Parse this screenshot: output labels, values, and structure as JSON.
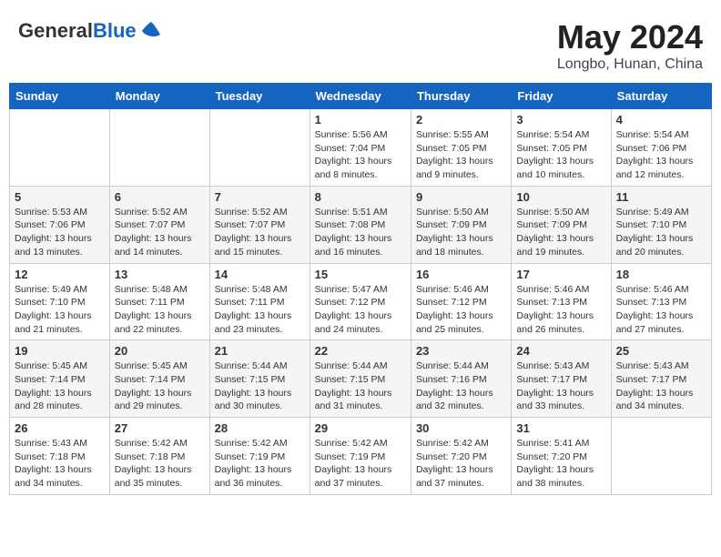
{
  "header": {
    "logo_general": "General",
    "logo_blue": "Blue",
    "title": "May 2024",
    "location": "Longbo, Hunan, China"
  },
  "weekdays": [
    "Sunday",
    "Monday",
    "Tuesday",
    "Wednesday",
    "Thursday",
    "Friday",
    "Saturday"
  ],
  "weeks": [
    [
      {
        "day": "",
        "info": ""
      },
      {
        "day": "",
        "info": ""
      },
      {
        "day": "",
        "info": ""
      },
      {
        "day": "1",
        "info": "Sunrise: 5:56 AM\nSunset: 7:04 PM\nDaylight: 13 hours\nand 8 minutes."
      },
      {
        "day": "2",
        "info": "Sunrise: 5:55 AM\nSunset: 7:05 PM\nDaylight: 13 hours\nand 9 minutes."
      },
      {
        "day": "3",
        "info": "Sunrise: 5:54 AM\nSunset: 7:05 PM\nDaylight: 13 hours\nand 10 minutes."
      },
      {
        "day": "4",
        "info": "Sunrise: 5:54 AM\nSunset: 7:06 PM\nDaylight: 13 hours\nand 12 minutes."
      }
    ],
    [
      {
        "day": "5",
        "info": "Sunrise: 5:53 AM\nSunset: 7:06 PM\nDaylight: 13 hours\nand 13 minutes."
      },
      {
        "day": "6",
        "info": "Sunrise: 5:52 AM\nSunset: 7:07 PM\nDaylight: 13 hours\nand 14 minutes."
      },
      {
        "day": "7",
        "info": "Sunrise: 5:52 AM\nSunset: 7:07 PM\nDaylight: 13 hours\nand 15 minutes."
      },
      {
        "day": "8",
        "info": "Sunrise: 5:51 AM\nSunset: 7:08 PM\nDaylight: 13 hours\nand 16 minutes."
      },
      {
        "day": "9",
        "info": "Sunrise: 5:50 AM\nSunset: 7:09 PM\nDaylight: 13 hours\nand 18 minutes."
      },
      {
        "day": "10",
        "info": "Sunrise: 5:50 AM\nSunset: 7:09 PM\nDaylight: 13 hours\nand 19 minutes."
      },
      {
        "day": "11",
        "info": "Sunrise: 5:49 AM\nSunset: 7:10 PM\nDaylight: 13 hours\nand 20 minutes."
      }
    ],
    [
      {
        "day": "12",
        "info": "Sunrise: 5:49 AM\nSunset: 7:10 PM\nDaylight: 13 hours\nand 21 minutes."
      },
      {
        "day": "13",
        "info": "Sunrise: 5:48 AM\nSunset: 7:11 PM\nDaylight: 13 hours\nand 22 minutes."
      },
      {
        "day": "14",
        "info": "Sunrise: 5:48 AM\nSunset: 7:11 PM\nDaylight: 13 hours\nand 23 minutes."
      },
      {
        "day": "15",
        "info": "Sunrise: 5:47 AM\nSunset: 7:12 PM\nDaylight: 13 hours\nand 24 minutes."
      },
      {
        "day": "16",
        "info": "Sunrise: 5:46 AM\nSunset: 7:12 PM\nDaylight: 13 hours\nand 25 minutes."
      },
      {
        "day": "17",
        "info": "Sunrise: 5:46 AM\nSunset: 7:13 PM\nDaylight: 13 hours\nand 26 minutes."
      },
      {
        "day": "18",
        "info": "Sunrise: 5:46 AM\nSunset: 7:13 PM\nDaylight: 13 hours\nand 27 minutes."
      }
    ],
    [
      {
        "day": "19",
        "info": "Sunrise: 5:45 AM\nSunset: 7:14 PM\nDaylight: 13 hours\nand 28 minutes."
      },
      {
        "day": "20",
        "info": "Sunrise: 5:45 AM\nSunset: 7:14 PM\nDaylight: 13 hours\nand 29 minutes."
      },
      {
        "day": "21",
        "info": "Sunrise: 5:44 AM\nSunset: 7:15 PM\nDaylight: 13 hours\nand 30 minutes."
      },
      {
        "day": "22",
        "info": "Sunrise: 5:44 AM\nSunset: 7:15 PM\nDaylight: 13 hours\nand 31 minutes."
      },
      {
        "day": "23",
        "info": "Sunrise: 5:44 AM\nSunset: 7:16 PM\nDaylight: 13 hours\nand 32 minutes."
      },
      {
        "day": "24",
        "info": "Sunrise: 5:43 AM\nSunset: 7:17 PM\nDaylight: 13 hours\nand 33 minutes."
      },
      {
        "day": "25",
        "info": "Sunrise: 5:43 AM\nSunset: 7:17 PM\nDaylight: 13 hours\nand 34 minutes."
      }
    ],
    [
      {
        "day": "26",
        "info": "Sunrise: 5:43 AM\nSunset: 7:18 PM\nDaylight: 13 hours\nand 34 minutes."
      },
      {
        "day": "27",
        "info": "Sunrise: 5:42 AM\nSunset: 7:18 PM\nDaylight: 13 hours\nand 35 minutes."
      },
      {
        "day": "28",
        "info": "Sunrise: 5:42 AM\nSunset: 7:19 PM\nDaylight: 13 hours\nand 36 minutes."
      },
      {
        "day": "29",
        "info": "Sunrise: 5:42 AM\nSunset: 7:19 PM\nDaylight: 13 hours\nand 37 minutes."
      },
      {
        "day": "30",
        "info": "Sunrise: 5:42 AM\nSunset: 7:20 PM\nDaylight: 13 hours\nand 37 minutes."
      },
      {
        "day": "31",
        "info": "Sunrise: 5:41 AM\nSunset: 7:20 PM\nDaylight: 13 hours\nand 38 minutes."
      },
      {
        "day": "",
        "info": ""
      }
    ]
  ]
}
